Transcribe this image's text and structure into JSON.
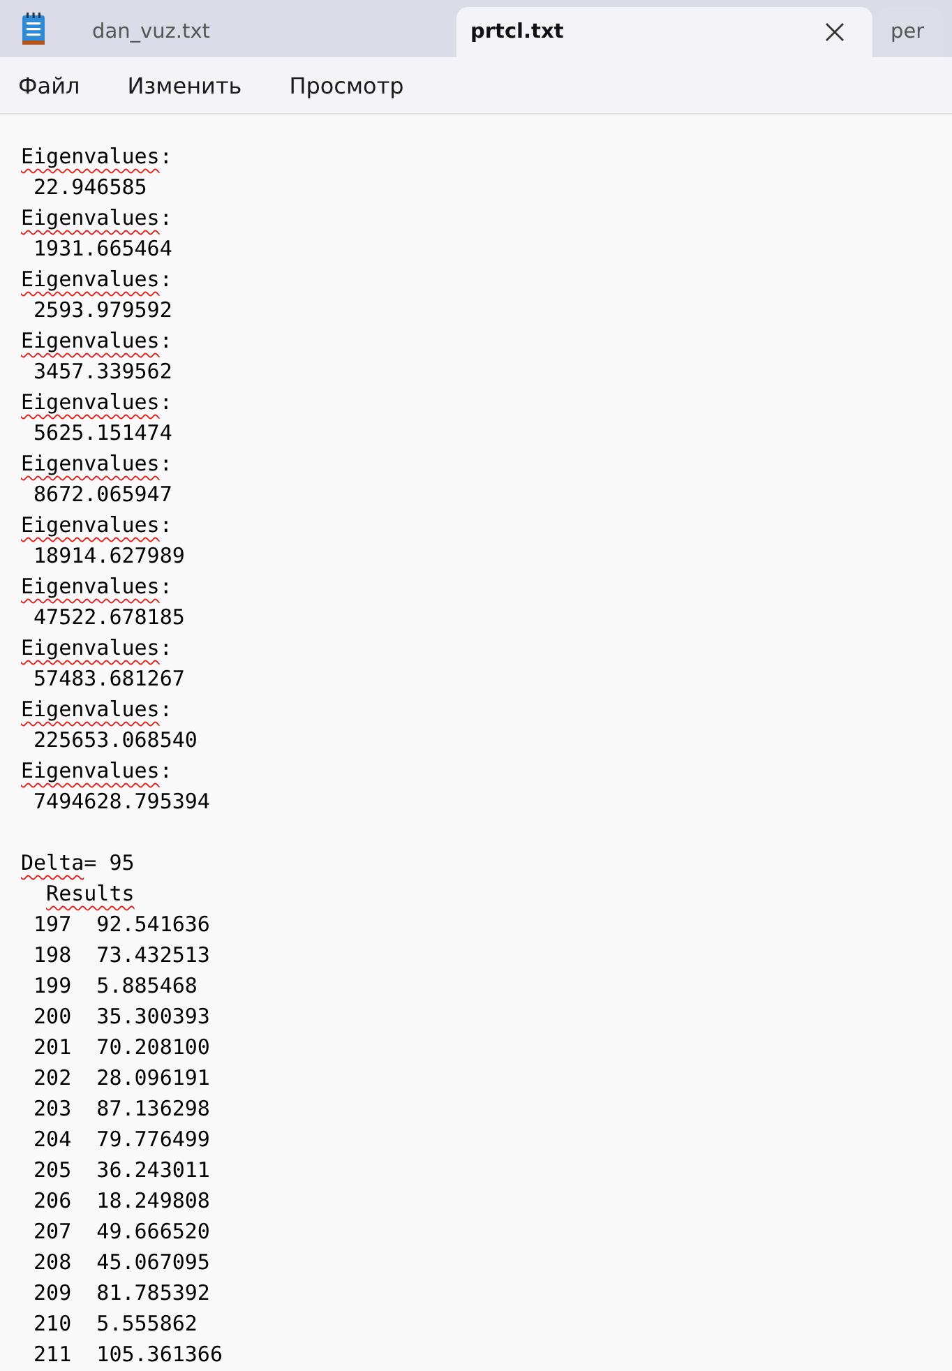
{
  "tabs": [
    {
      "label": "dan_vuz.txt",
      "selected": false,
      "closable": false
    },
    {
      "label": "prtcl.txt",
      "selected": true,
      "closable": true
    },
    {
      "label": "per",
      "selected": false,
      "closable": false
    }
  ],
  "menu": [
    "Файл",
    "Изменить",
    "Просмотр"
  ],
  "lines": [
    {
      "kind": "text",
      "segments": [
        {
          "text": "Eigenvalues",
          "misspelled": true
        },
        {
          "text": ":",
          "misspelled": false
        }
      ]
    },
    {
      "kind": "text",
      "segments": [
        {
          "text": " 22.946585",
          "misspelled": false
        }
      ]
    },
    {
      "kind": "text",
      "segments": [
        {
          "text": "Eigenvalues",
          "misspelled": true
        },
        {
          "text": ":",
          "misspelled": false
        }
      ]
    },
    {
      "kind": "text",
      "segments": [
        {
          "text": " 1931.665464",
          "misspelled": false
        }
      ]
    },
    {
      "kind": "text",
      "segments": [
        {
          "text": "Eigenvalues",
          "misspelled": true
        },
        {
          "text": ":",
          "misspelled": false
        }
      ]
    },
    {
      "kind": "text",
      "segments": [
        {
          "text": " 2593.979592",
          "misspelled": false
        }
      ]
    },
    {
      "kind": "text",
      "segments": [
        {
          "text": "Eigenvalues",
          "misspelled": true
        },
        {
          "text": ":",
          "misspelled": false
        }
      ]
    },
    {
      "kind": "text",
      "segments": [
        {
          "text": " 3457.339562",
          "misspelled": false
        }
      ]
    },
    {
      "kind": "text",
      "segments": [
        {
          "text": "Eigenvalues",
          "misspelled": true
        },
        {
          "text": ":",
          "misspelled": false
        }
      ]
    },
    {
      "kind": "text",
      "segments": [
        {
          "text": " 5625.151474",
          "misspelled": false
        }
      ]
    },
    {
      "kind": "text",
      "segments": [
        {
          "text": "Eigenvalues",
          "misspelled": true
        },
        {
          "text": ":",
          "misspelled": false
        }
      ]
    },
    {
      "kind": "text",
      "segments": [
        {
          "text": " 8672.065947",
          "misspelled": false
        }
      ]
    },
    {
      "kind": "text",
      "segments": [
        {
          "text": "Eigenvalues",
          "misspelled": true
        },
        {
          "text": ":",
          "misspelled": false
        }
      ]
    },
    {
      "kind": "text",
      "segments": [
        {
          "text": " 18914.627989",
          "misspelled": false
        }
      ]
    },
    {
      "kind": "text",
      "segments": [
        {
          "text": "Eigenvalues",
          "misspelled": true
        },
        {
          "text": ":",
          "misspelled": false
        }
      ]
    },
    {
      "kind": "text",
      "segments": [
        {
          "text": " 47522.678185",
          "misspelled": false
        }
      ]
    },
    {
      "kind": "text",
      "segments": [
        {
          "text": "Eigenvalues",
          "misspelled": true
        },
        {
          "text": ":",
          "misspelled": false
        }
      ]
    },
    {
      "kind": "text",
      "segments": [
        {
          "text": " 57483.681267",
          "misspelled": false
        }
      ]
    },
    {
      "kind": "text",
      "segments": [
        {
          "text": "Eigenvalues",
          "misspelled": true
        },
        {
          "text": ":",
          "misspelled": false
        }
      ]
    },
    {
      "kind": "text",
      "segments": [
        {
          "text": " 225653.068540",
          "misspelled": false
        }
      ]
    },
    {
      "kind": "text",
      "segments": [
        {
          "text": "Eigenvalues",
          "misspelled": true
        },
        {
          "text": ":",
          "misspelled": false
        }
      ]
    },
    {
      "kind": "text",
      "segments": [
        {
          "text": " 7494628.795394",
          "misspelled": false
        }
      ]
    },
    {
      "kind": "blank"
    },
    {
      "kind": "text",
      "segments": [
        {
          "text": "Delta",
          "misspelled": true
        },
        {
          "text": "= 95",
          "misspelled": false
        }
      ]
    },
    {
      "kind": "text",
      "indented": true,
      "segments": [
        {
          "text": "Results",
          "misspelled": true
        }
      ]
    },
    {
      "kind": "text",
      "segments": [
        {
          "text": " 197  92.541636",
          "misspelled": false
        }
      ]
    },
    {
      "kind": "text",
      "segments": [
        {
          "text": " 198  73.432513",
          "misspelled": false
        }
      ]
    },
    {
      "kind": "text",
      "segments": [
        {
          "text": " 199  5.885468",
          "misspelled": false
        }
      ]
    },
    {
      "kind": "text",
      "segments": [
        {
          "text": " 200  35.300393",
          "misspelled": false
        }
      ]
    },
    {
      "kind": "text",
      "segments": [
        {
          "text": " 201  70.208100",
          "misspelled": false
        }
      ]
    },
    {
      "kind": "text",
      "segments": [
        {
          "text": " 202  28.096191",
          "misspelled": false
        }
      ]
    },
    {
      "kind": "text",
      "segments": [
        {
          "text": " 203  87.136298",
          "misspelled": false
        }
      ]
    },
    {
      "kind": "text",
      "segments": [
        {
          "text": " 204  79.776499",
          "misspelled": false
        }
      ]
    },
    {
      "kind": "text",
      "segments": [
        {
          "text": " 205  36.243011",
          "misspelled": false
        }
      ]
    },
    {
      "kind": "text",
      "segments": [
        {
          "text": " 206  18.249808",
          "misspelled": false
        }
      ]
    },
    {
      "kind": "text",
      "segments": [
        {
          "text": " 207  49.666520",
          "misspelled": false
        }
      ]
    },
    {
      "kind": "text",
      "segments": [
        {
          "text": " 208  45.067095",
          "misspelled": false
        }
      ]
    },
    {
      "kind": "text",
      "segments": [
        {
          "text": " 209  81.785392",
          "misspelled": false
        }
      ]
    },
    {
      "kind": "text",
      "segments": [
        {
          "text": " 210  5.555862",
          "misspelled": false
        }
      ]
    },
    {
      "kind": "text",
      "segments": [
        {
          "text": " 211  105.361366",
          "misspelled": false
        }
      ]
    }
  ]
}
